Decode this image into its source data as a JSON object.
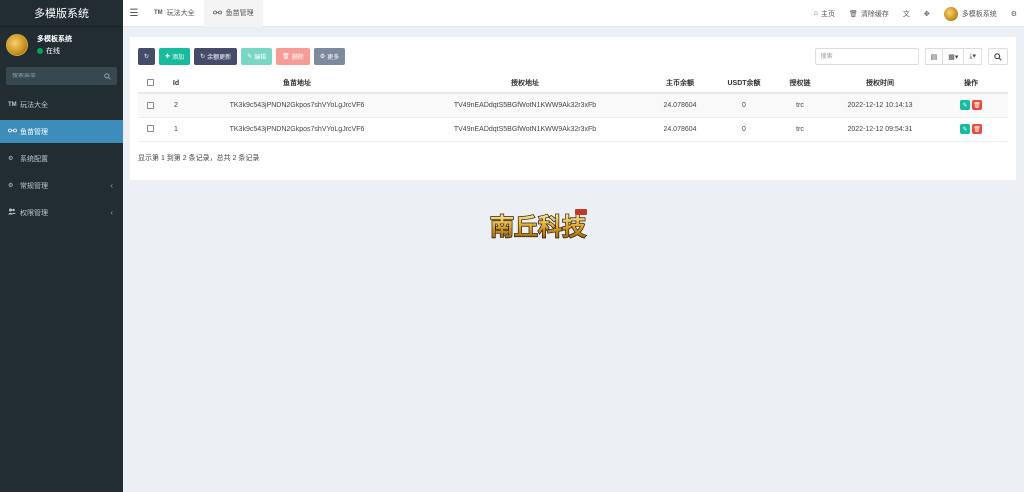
{
  "sidebar": {
    "logo": "多模版系统",
    "user": {
      "name": "多模板系统",
      "status": "在线"
    },
    "search_placeholder": "搜索菜单",
    "items": [
      {
        "icon": "TM",
        "label": "玩法大全"
      },
      {
        "icon": "glasses-icon",
        "label": "鱼苗管理"
      },
      {
        "icon": "gear-icon",
        "label": "系统配置"
      },
      {
        "icon": "cogs-icon",
        "label": "常规管理"
      },
      {
        "icon": "users-icon",
        "label": "权限管理"
      }
    ]
  },
  "header": {
    "tabs": [
      {
        "icon": "TM",
        "label": "玩法大全"
      },
      {
        "icon": "glasses-icon",
        "label": "鱼苗管理"
      }
    ],
    "right": {
      "home": "主页",
      "clear_cache": "清除缓存",
      "user": "多模板系统"
    }
  },
  "toolbar": {
    "add": "添加",
    "balance_update": "余额更新",
    "edit": "编辑",
    "delete": "删除",
    "more": "更多",
    "search_placeholder": "搜索"
  },
  "table": {
    "headers": [
      "Id",
      "鱼苗地址",
      "授权地址",
      "主币余额",
      "USDT余额",
      "授权链",
      "授权时间",
      "操作"
    ],
    "rows": [
      {
        "id": "2",
        "fish_address": "TK3k9c543jPNDN2Gkpos7shVYoLgJrcVF6",
        "auth_address": "TV49nEADdqtS5BGfWotN1KWW9Ak32r3xFb",
        "main_balance": "24.078604",
        "usdt_balance": "0",
        "chain": "trc",
        "auth_time": "2022-12-12 10:14:13"
      },
      {
        "id": "1",
        "fish_address": "TK3k9c543jPNDN2Gkpos7shVYoLgJrcVF6",
        "auth_address": "TV49nEADdqtS5BGfWotN1KWW9Ak32r3xFb",
        "main_balance": "24.078604",
        "usdt_balance": "0",
        "chain": "trc",
        "auth_time": "2022-12-12 09:54:31"
      }
    ],
    "summary": "显示第 1 到第 2 条记录，总共 2 条记录"
  },
  "brand": {
    "text": "南丘科技"
  },
  "colors": {
    "sidebar": "#222d32",
    "active": "#3c8dbc",
    "green": "#18bc9c",
    "red": "#e74c3c",
    "dark": "#444c69"
  }
}
